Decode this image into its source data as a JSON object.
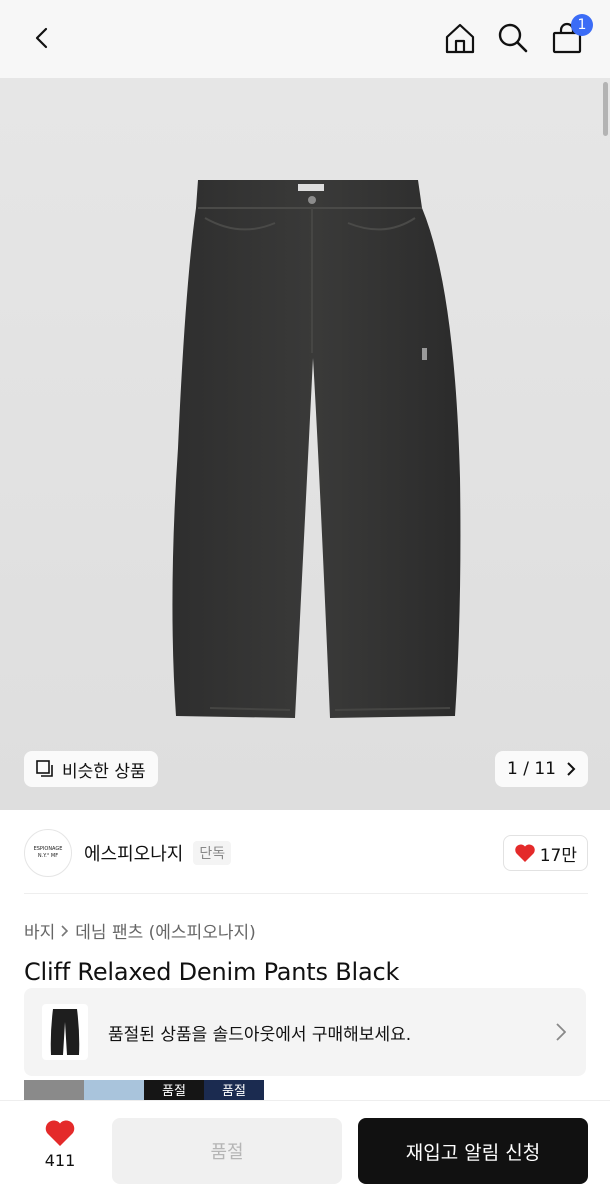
{
  "header": {
    "cart_badge": "1",
    "icons": [
      "back-icon",
      "home-icon",
      "search-icon",
      "cart-icon"
    ]
  },
  "hero": {
    "similar_label": "비슷한 상품",
    "pager": "1 / 11",
    "background": "#e3e3e3"
  },
  "brand": {
    "logo_line1": "ESPIONAGE",
    "logo_line2": "N.Y.° MF",
    "name": "에스피오나지",
    "tag": "단독",
    "likes": "17만"
  },
  "breadcrumb": [
    "바지",
    "데님 팬츠 (에스피오나지)"
  ],
  "product": {
    "title": "Cliff Relaxed Denim Pants Black"
  },
  "soldout_banner": {
    "text": "품절된 상품을 솔드아웃에서 구매해보세요."
  },
  "thumbs": [
    {
      "label": "",
      "color": "#8a8a8a"
    },
    {
      "label": "",
      "color": "#a9c4dc"
    },
    {
      "label": "품절",
      "color": "#151515"
    },
    {
      "label": "품절",
      "color": "#1b2b50"
    }
  ],
  "bottom_bar": {
    "wish_count": "411",
    "soldout_label": "품절",
    "restock_label": "재입고 알림 신청"
  },
  "colors": {
    "accent": "#3b6cf6",
    "heart": "#e42a2a",
    "primary_button": "#111111"
  }
}
